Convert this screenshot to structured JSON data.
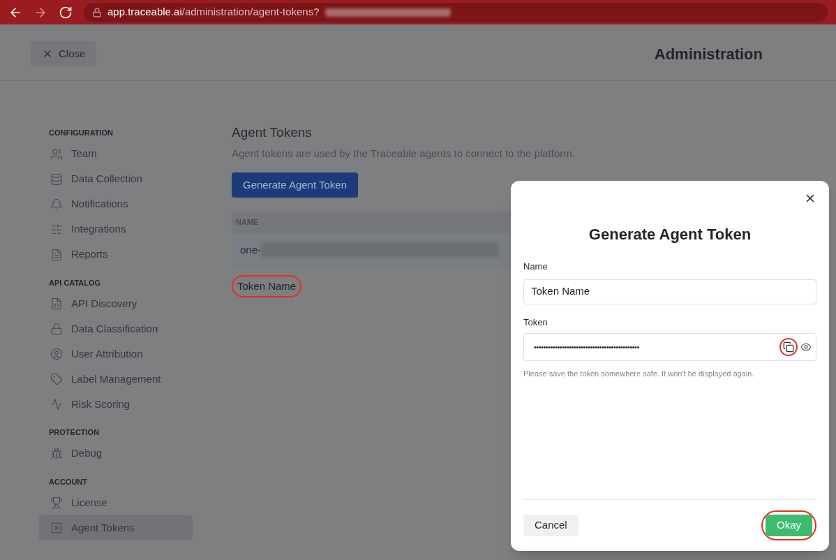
{
  "browser": {
    "url_host": "app.traceable.ai",
    "url_path": "/administration/agent-tokens?"
  },
  "header": {
    "close_button": "Close",
    "title": "Administration"
  },
  "sidebar": {
    "sections": [
      {
        "heading": "CONFIGURATION",
        "items": [
          {
            "label": "Team",
            "selected": false
          },
          {
            "label": "Data Collection",
            "selected": false
          },
          {
            "label": "Notifications",
            "selected": false
          },
          {
            "label": "Integrations",
            "selected": false
          },
          {
            "label": "Reports",
            "selected": false
          }
        ]
      },
      {
        "heading": "API CATALOG",
        "items": [
          {
            "label": "API Discovery",
            "selected": false
          },
          {
            "label": "Data Classification",
            "selected": false
          },
          {
            "label": "User Attribution",
            "selected": false
          },
          {
            "label": "Label Management",
            "selected": false
          },
          {
            "label": "Risk Scoring",
            "selected": false
          }
        ]
      },
      {
        "heading": "PROTECTION",
        "items": [
          {
            "label": "Debug",
            "selected": false
          }
        ]
      },
      {
        "heading": "ACCOUNT",
        "items": [
          {
            "label": "License",
            "selected": false
          },
          {
            "label": "Agent Tokens",
            "selected": true
          }
        ]
      }
    ]
  },
  "main": {
    "title": "Agent Tokens",
    "description": "Agent tokens are used by the Traceable agents to connect to the platform.",
    "generate_button": "Generate Agent Token",
    "table": {
      "columns": [
        "NAME"
      ],
      "rows": [
        {
          "name": "one-"
        }
      ]
    },
    "caption": {
      "text": "Token Name",
      "highlighted": true
    }
  },
  "dialog": {
    "title": "Generate Agent Token",
    "name_field": {
      "label": "Name",
      "value": "Token Name"
    },
    "token_field": {
      "label": "Token",
      "value": "•••••••••••••••••••••••••••••••••••••••••••••",
      "copy_highlighted": true
    },
    "help": "Please save the token somewhere safe. It won't be displayed again.",
    "cancel_button": "Cancel",
    "ok_button": {
      "label": "Okay",
      "highlighted": true
    }
  }
}
